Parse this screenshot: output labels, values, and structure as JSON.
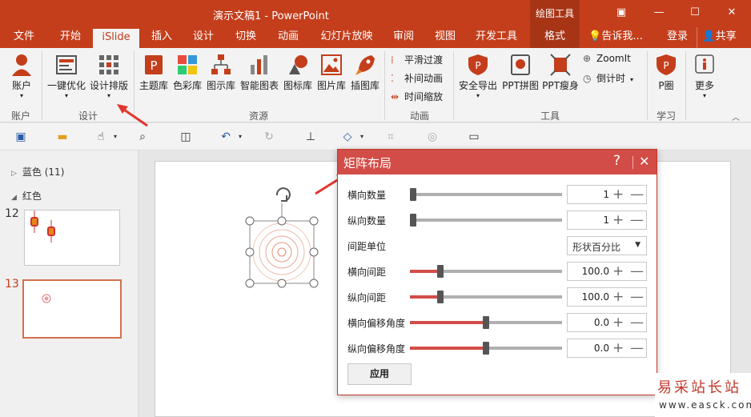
{
  "window": {
    "title": "演示文稿1 - PowerPoint",
    "context_tab_header": "绘图工具",
    "controls": {
      "ribbon_display": "▣",
      "minimize": "—",
      "maximize": "☐",
      "close": "✕"
    }
  },
  "tabs": [
    "文件",
    "开始",
    "iSlide",
    "插入",
    "设计",
    "切换",
    "动画",
    "幻灯片放映",
    "审阅",
    "视图",
    "开发工具",
    "格式"
  ],
  "active_tab": "iSlide",
  "tell_me": "告诉我...",
  "sign_in": "登录",
  "share": "共享",
  "ribbon": {
    "groups": [
      {
        "label": "账户",
        "buttons": [
          "账户"
        ]
      },
      {
        "label": "设计",
        "buttons": [
          "一键优化",
          "设计排版"
        ]
      },
      {
        "label": "资源",
        "buttons": [
          "主题库",
          "色彩库",
          "图示库",
          "智能图表",
          "图标库",
          "图片库",
          "插图库"
        ]
      },
      {
        "label": "动画",
        "small_buttons": [
          "平滑过渡",
          "补间动画",
          "时间缩放"
        ]
      },
      {
        "label": "工具",
        "buttons": [
          "安全导出",
          "PPT拼图",
          "PPT瘦身"
        ],
        "small_buttons": [
          "ZoomIt",
          "倒计时"
        ]
      },
      {
        "label": "学习",
        "buttons": [
          "P圈"
        ]
      },
      {
        "label": "",
        "buttons": [
          "更多"
        ]
      }
    ]
  },
  "left_pane": {
    "sections": [
      {
        "name": "蓝色 (11)",
        "collapsed": true
      },
      {
        "name": "红色",
        "collapsed": false
      }
    ],
    "slides": [
      {
        "number": "12",
        "selected": false
      },
      {
        "number": "13",
        "selected": true
      }
    ]
  },
  "dialog": {
    "title": "矩阵布局",
    "help": "?",
    "close": "✕",
    "rows": [
      {
        "label": "横向数量",
        "value": "1",
        "level": 0.0
      },
      {
        "label": "纵向数量",
        "value": "1",
        "level": 0.0
      },
      {
        "label": "横向间距",
        "value": "100.0",
        "level": 0.2
      },
      {
        "label": "纵向间距",
        "value": "100.0",
        "level": 0.2
      },
      {
        "label": "横向偏移角度",
        "value": "0.0",
        "level": 0.5
      },
      {
        "label": "纵向偏移角度",
        "value": "0.0",
        "level": 0.5
      }
    ],
    "spacing_unit_label": "间距单位",
    "spacing_unit_value": "形状百分比",
    "apply": "应用"
  },
  "watermark": {
    "main": "易采站长站",
    "sub": "www.easck.com"
  },
  "colors": {
    "accent": "#c43e1c",
    "dialog_header": "#d24d47",
    "selected_slide_border": "#d4704e"
  }
}
